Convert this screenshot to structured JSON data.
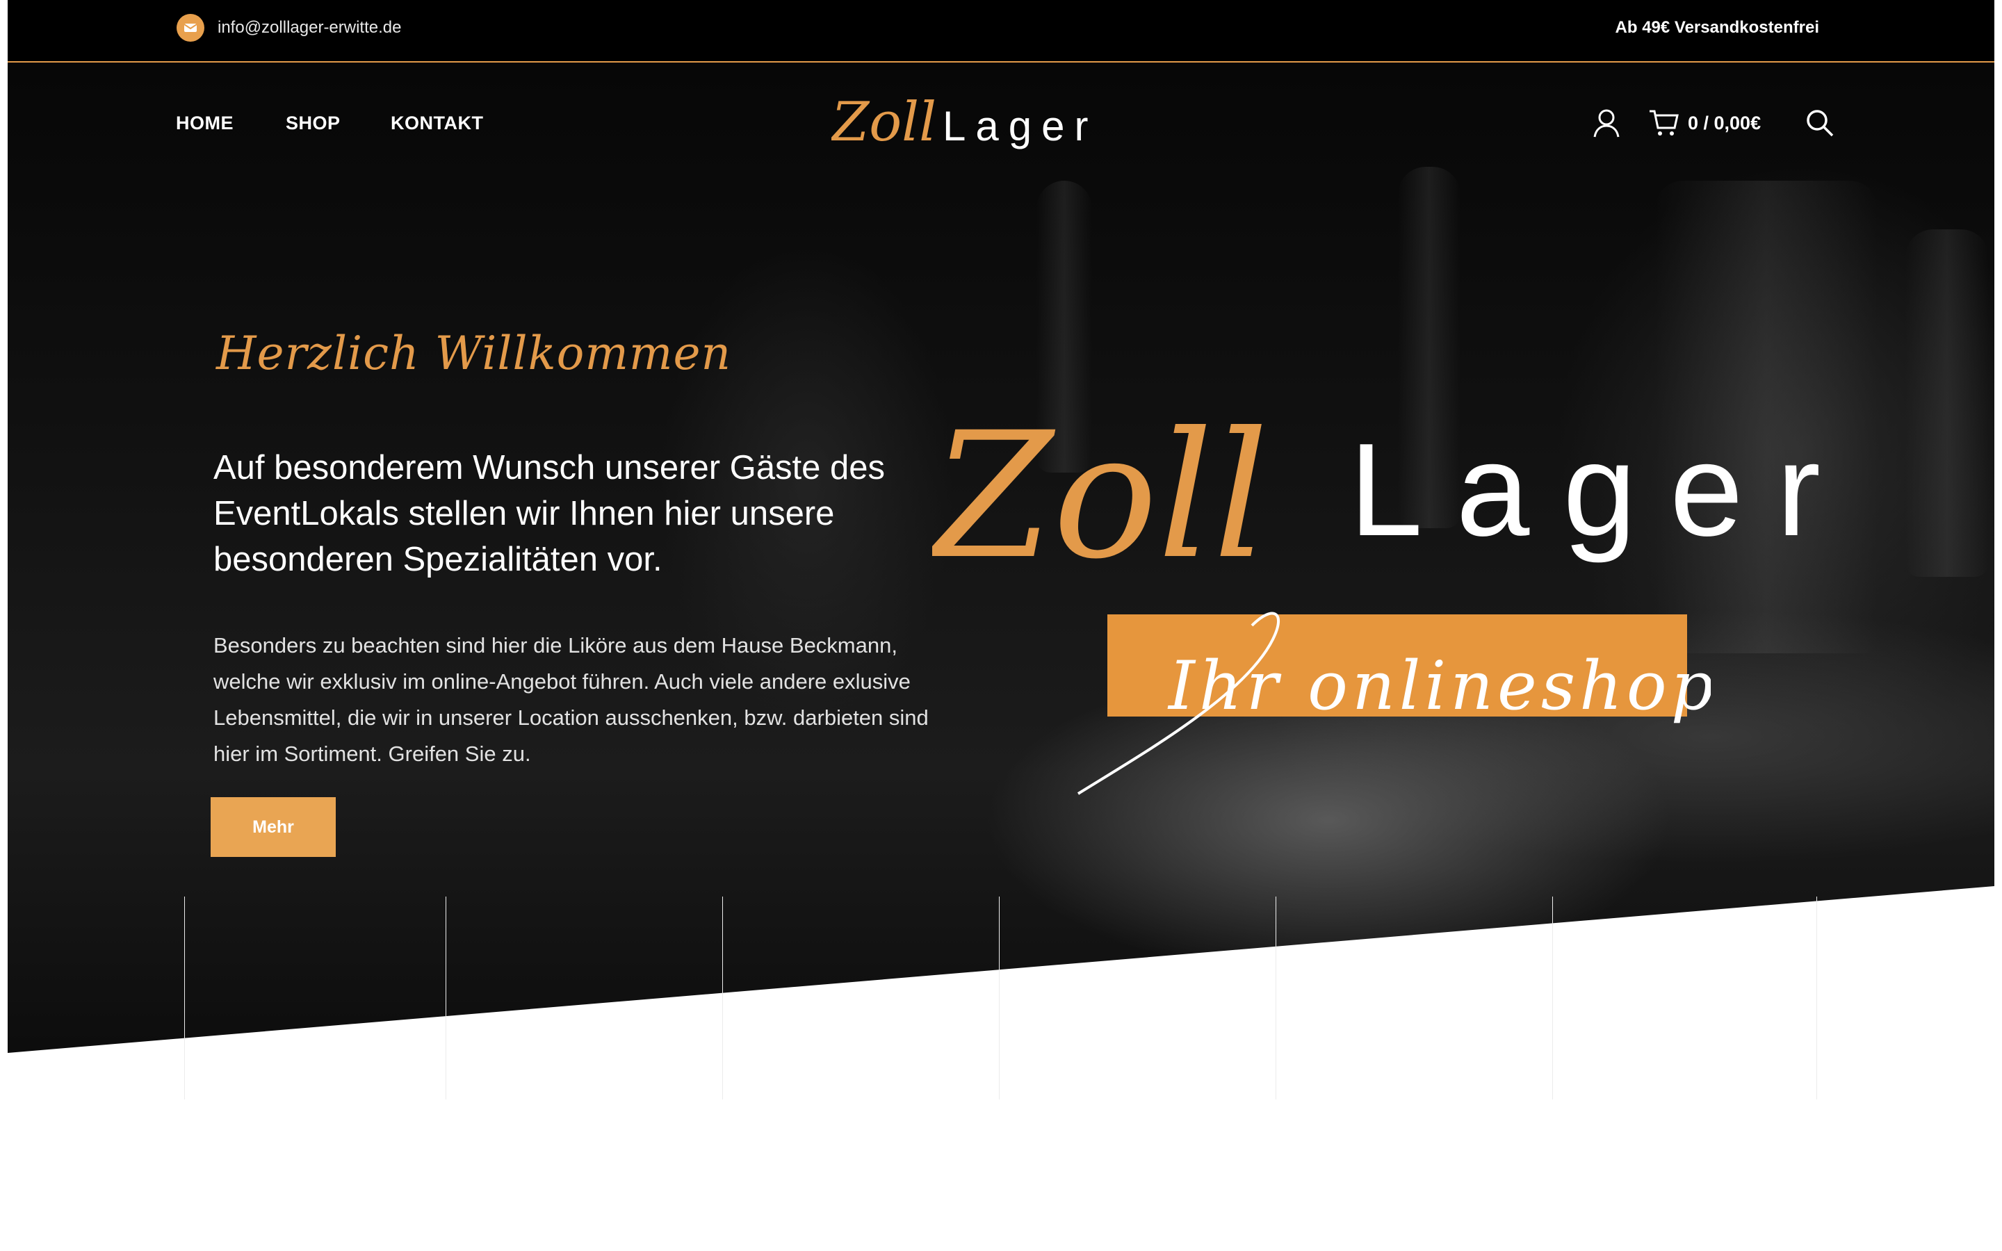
{
  "topbar": {
    "email": "info@zolllager-erwitte.de",
    "shipping_notice": "Ab 49€ Versandkostenfrei"
  },
  "nav": {
    "items": [
      {
        "label": "HOME"
      },
      {
        "label": "SHOP"
      },
      {
        "label": "KONTAKT"
      }
    ]
  },
  "logo": {
    "part_a": "Zoll",
    "part_b": "Lager"
  },
  "cart": {
    "summary": "0 / 0,00€"
  },
  "hero": {
    "welcome": "Herzlich Willkommen",
    "lead": "Auf besonderem Wunsch unserer Gäste des EventLokals stellen wir Ihnen hier unsere besonderen Spezialitäten vor.",
    "body": "Besonders zu beachten sind hier die Liköre aus dem Hause Beckmann, welche wir exklusiv im online-Angebot führen. Auch viele andere exlusive Lebensmittel, die wir in unserer Location ausschenken, bzw. darbieten sind hier im Sortiment. Greifen Sie zu.",
    "button": "Mehr",
    "big_logo_a": "Zoll",
    "big_logo_b": "Lager",
    "tagline": "Ihr onlineshop"
  },
  "colors": {
    "accent": "#e39a4a",
    "button": "#e9a553",
    "band": "#e6963d",
    "background": "#000000"
  },
  "icons": [
    "mail-icon",
    "user-icon",
    "cart-icon",
    "search-icon"
  ]
}
